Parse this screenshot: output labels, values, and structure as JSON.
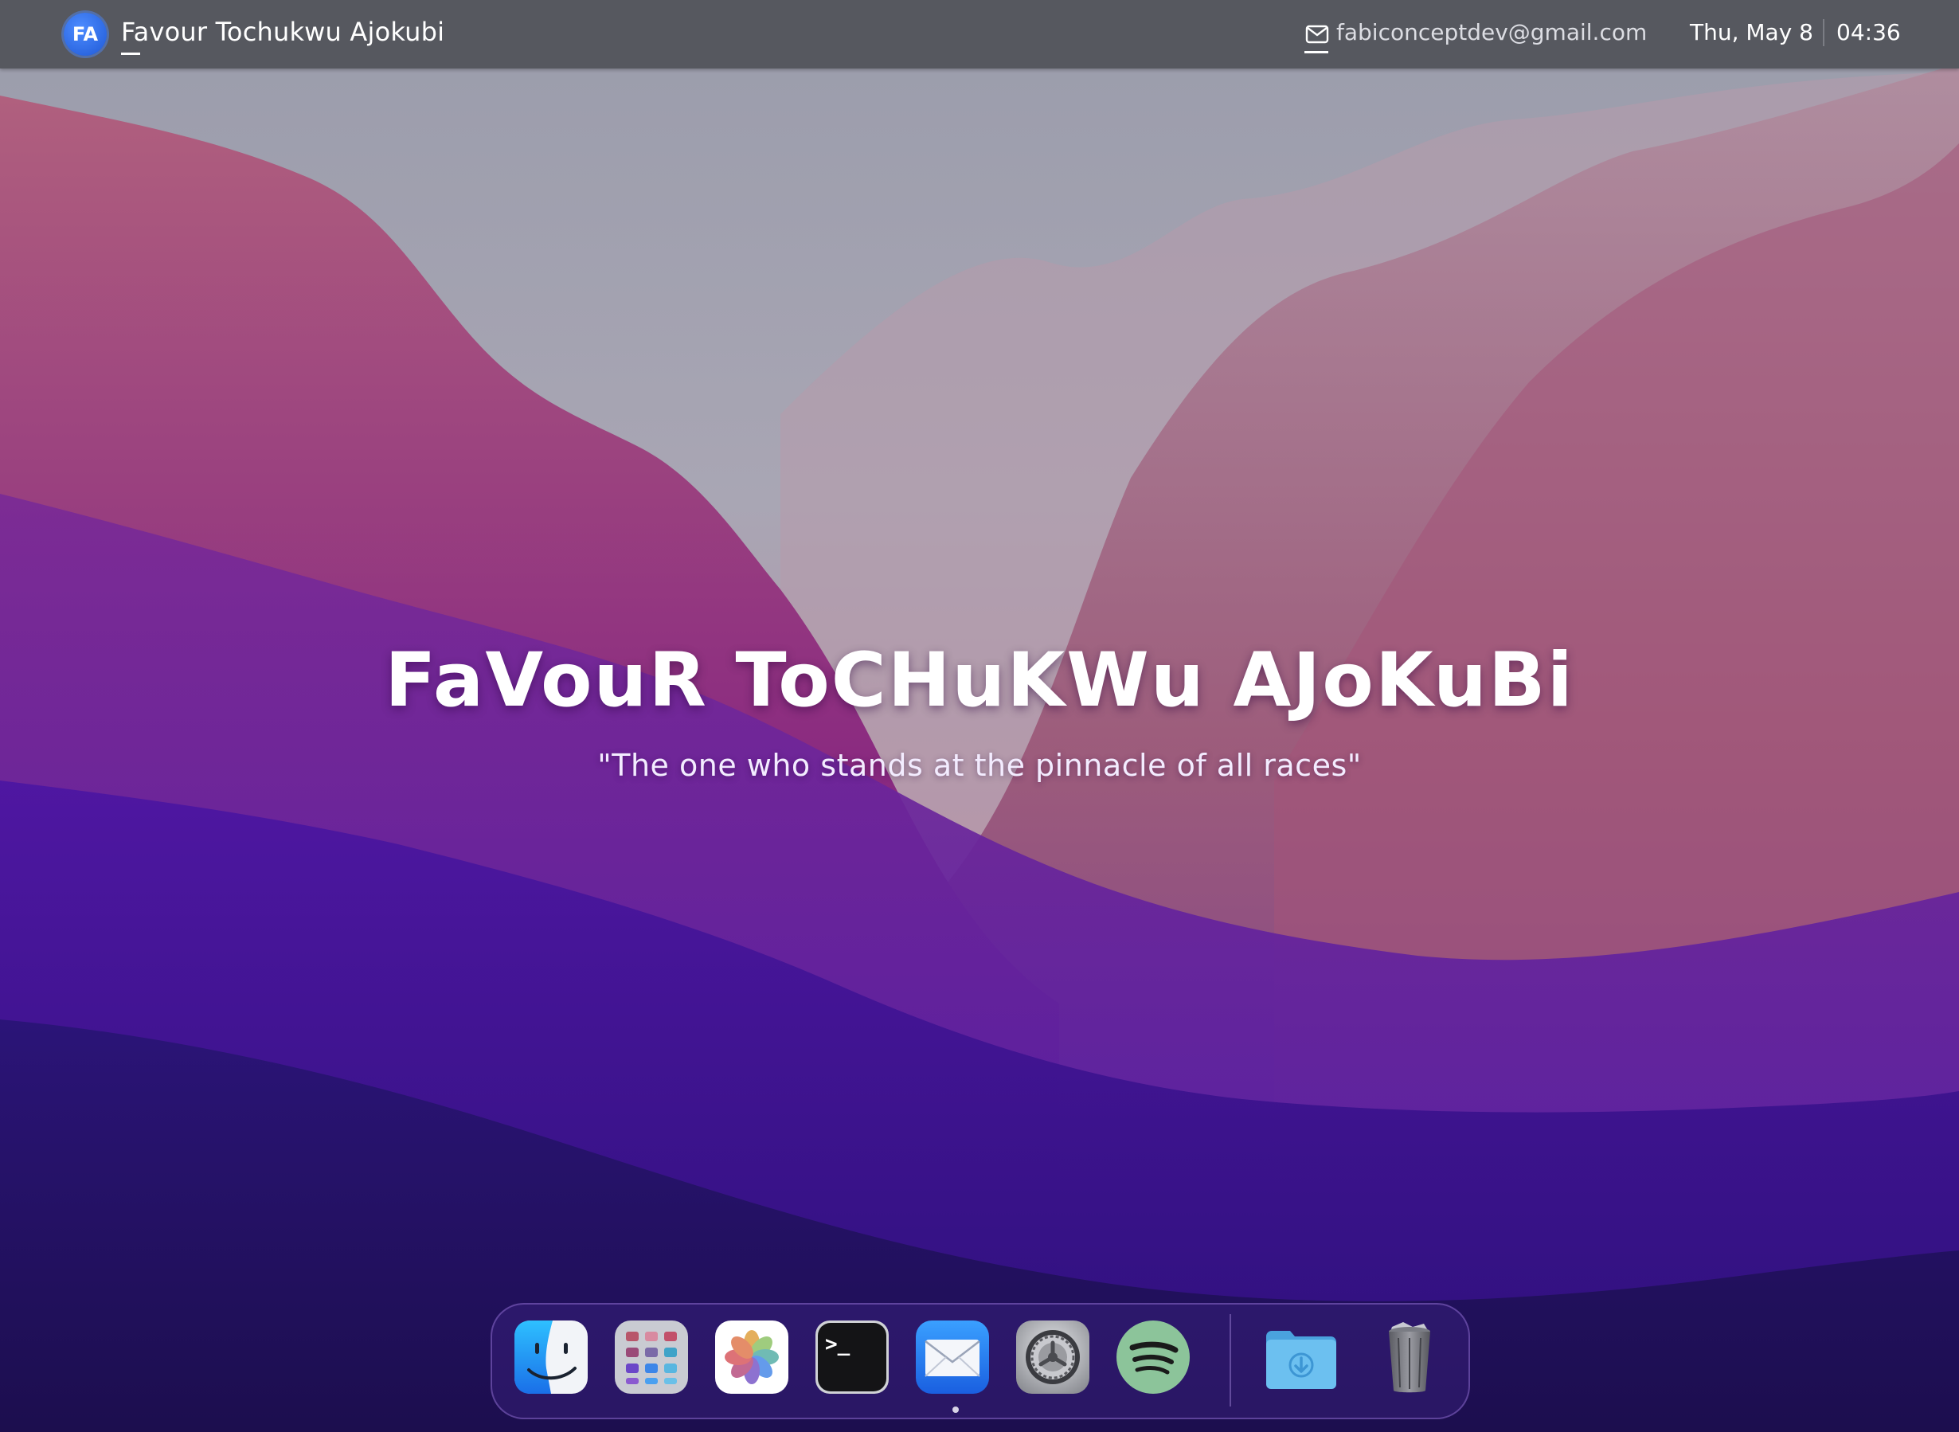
{
  "menubar": {
    "avatar_initials": "FA",
    "owner_name": "Favour Tochukwu Ajokubi",
    "email": "fabiconceptdev@gmail.com",
    "date": "Thu, May 8",
    "time": "04:36"
  },
  "hero": {
    "title": "FaVouR ToCHuKWu AJoKuBi",
    "quote": "\"The one who stands at the pinnacle of all races\""
  },
  "dock": {
    "items": [
      {
        "icon": "finder-icon"
      },
      {
        "icon": "launchpad-icon"
      },
      {
        "icon": "photos-icon"
      },
      {
        "icon": "terminal-icon",
        "glyph": ">_"
      },
      {
        "icon": "mail-app-icon"
      },
      {
        "icon": "system-settings-icon"
      },
      {
        "icon": "spotify-icon"
      },
      {
        "icon": "downloads-folder-icon"
      },
      {
        "icon": "trash-icon"
      }
    ],
    "running_indicator_under": "mail-app-icon"
  },
  "colors": {
    "menubar": "#56585f",
    "avatar": "#2f6ef0",
    "wallpaper_top": "#a6a8b4",
    "wallpaper_bottom": "#1e1050"
  }
}
